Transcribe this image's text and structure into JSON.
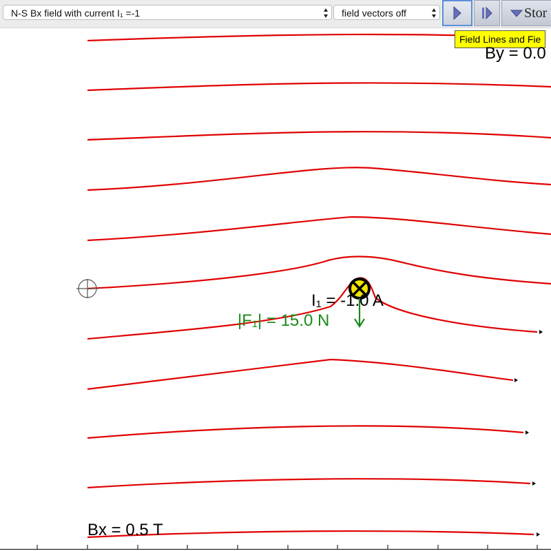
{
  "toolbar": {
    "field_select": {
      "value": "N-S Bx field with current I₁ =-1"
    },
    "vectors_select": {
      "value": "field vectors off"
    },
    "play_icon": "play-icon",
    "step_icon": "step-icon",
    "stored_label": "Stor",
    "stored_icon": "triangle-down-icon"
  },
  "tooltip": {
    "text": "Field Lines and Fie"
  },
  "readouts": {
    "by": "By = 0.0",
    "bx": "Bx = 0.5 T",
    "current": "I₁ = -1.0 A",
    "force": "|F₁| = 15.0 N"
  },
  "colors": {
    "field_line": "#e00000",
    "force_vector": "#1a8a1a",
    "wire_fill": "#f2e500",
    "tooltip_bg": "#ffff00"
  },
  "wire": {
    "symbol": "into-page-current-icon"
  }
}
